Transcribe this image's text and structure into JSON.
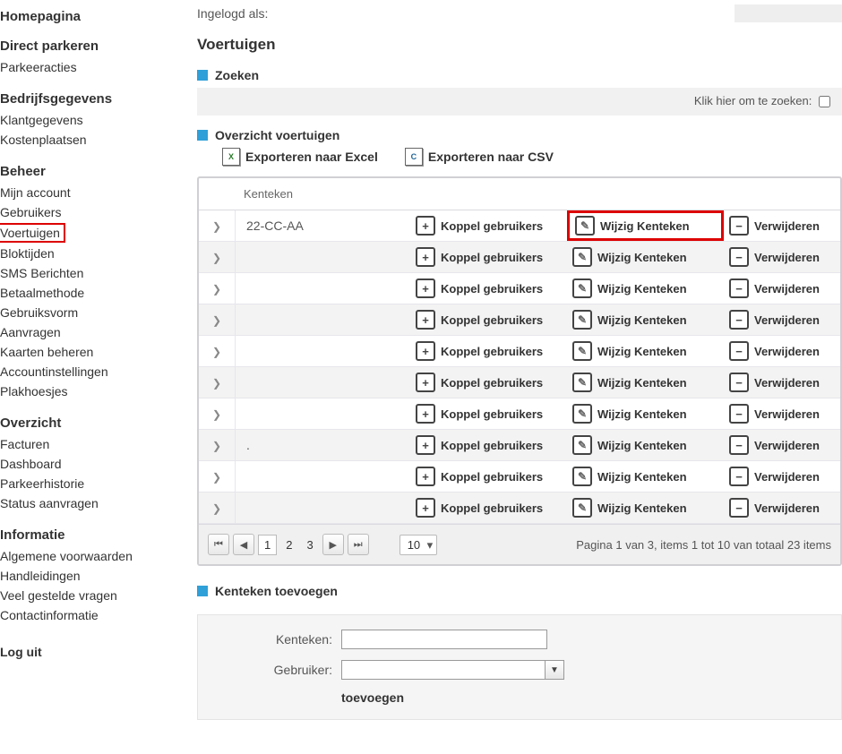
{
  "topbar": {
    "logged_in_as": "Ingelogd als:"
  },
  "page_title": "Voertuigen",
  "search": {
    "label": "Zoeken",
    "hint": "Klik hier om te zoeken:"
  },
  "overview": {
    "label": "Overzicht voertuigen",
    "export_excel": "Exporteren naar Excel",
    "export_csv": "Exporteren naar CSV"
  },
  "grid": {
    "header_kenteken": "Kenteken",
    "btn_koppel": "Koppel gebruikers",
    "btn_wijzig": "Wijzig Kenteken",
    "btn_verwijder": "Verwijderen",
    "rows": [
      {
        "kenteken": "22-CC-AA"
      },
      {
        "kenteken": ""
      },
      {
        "kenteken": ""
      },
      {
        "kenteken": ""
      },
      {
        "kenteken": ""
      },
      {
        "kenteken": ""
      },
      {
        "kenteken": ""
      },
      {
        "kenteken": "."
      },
      {
        "kenteken": ""
      },
      {
        "kenteken": ""
      }
    ]
  },
  "pager": {
    "pages": [
      "1",
      "2",
      "3"
    ],
    "active_page": "1",
    "page_size": "10",
    "info": "Pagina 1 van 3, items 1 tot 10 van totaal 23 items"
  },
  "add_form": {
    "section_label": "Kenteken toevoegen",
    "label_kenteken": "Kenteken:",
    "label_gebruiker": "Gebruiker:",
    "submit": "toevoegen"
  },
  "sidebar": {
    "groups": [
      {
        "title": "Homepagina",
        "items": []
      },
      {
        "title": "Direct parkeren",
        "items": [
          "Parkeeracties"
        ]
      },
      {
        "title": "Bedrijfsgegevens",
        "items": [
          "Klantgegevens",
          "Kostenplaatsen"
        ]
      },
      {
        "title": "Beheer",
        "items": [
          "Mijn account",
          "Gebruikers",
          "Voertuigen",
          "Bloktijden",
          "SMS Berichten",
          "Betaalmethode",
          "Gebruiksvorm",
          "Aanvragen",
          "Kaarten beheren",
          "Accountinstellingen",
          "Plakhoesjes"
        ]
      },
      {
        "title": "Overzicht",
        "items": [
          "Facturen",
          "Dashboard",
          "Parkeerhistorie",
          "Status aanvragen"
        ]
      },
      {
        "title": "Informatie",
        "items": [
          "Algemene voorwaarden",
          "Handleidingen",
          "Veel gestelde vragen",
          "Contactinformatie"
        ]
      }
    ],
    "highlighted_item": "Voertuigen",
    "logout": "Log uit"
  }
}
